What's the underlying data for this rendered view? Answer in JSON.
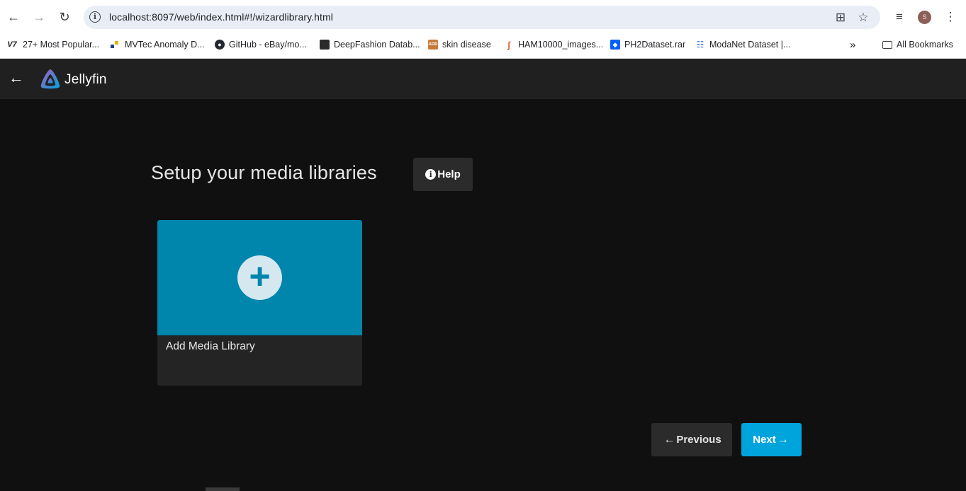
{
  "browser": {
    "url": "localhost:8097/web/index.html#!/wizardlibrary.html",
    "avatar_letter": "S",
    "bookmarks": [
      {
        "label": "27+ Most Popular...",
        "icon": "v7-icon",
        "badge": "V7"
      },
      {
        "label": "MVTec Anomaly D...",
        "icon": "mvtec-icon",
        "badge": ""
      },
      {
        "label": "GitHub - eBay/mo...",
        "icon": "github-icon",
        "badge": ""
      },
      {
        "label": "DeepFashion Datab...",
        "icon": "cube-icon",
        "badge": ""
      },
      {
        "label": "skin disease",
        "icon": "add-icon",
        "badge": "ADD"
      },
      {
        "label": "HAM10000_images...",
        "icon": "link-icon",
        "badge": ""
      },
      {
        "label": "PH2Dataset.rar",
        "icon": "dropbox-icon",
        "badge": ""
      },
      {
        "label": "ModaNet Dataset |...",
        "icon": "dataset-icon",
        "badge": ""
      }
    ],
    "all_bookmarks": "All Bookmarks",
    "overflow": "»"
  },
  "app": {
    "name": "Jellyfin",
    "accent": "#00a4dc"
  },
  "wizard": {
    "title": "Setup your media libraries",
    "help_label": "Help",
    "card_label": "Add Media Library",
    "card_plus": "+",
    "previous_label": "Previous",
    "next_label": "Next"
  }
}
